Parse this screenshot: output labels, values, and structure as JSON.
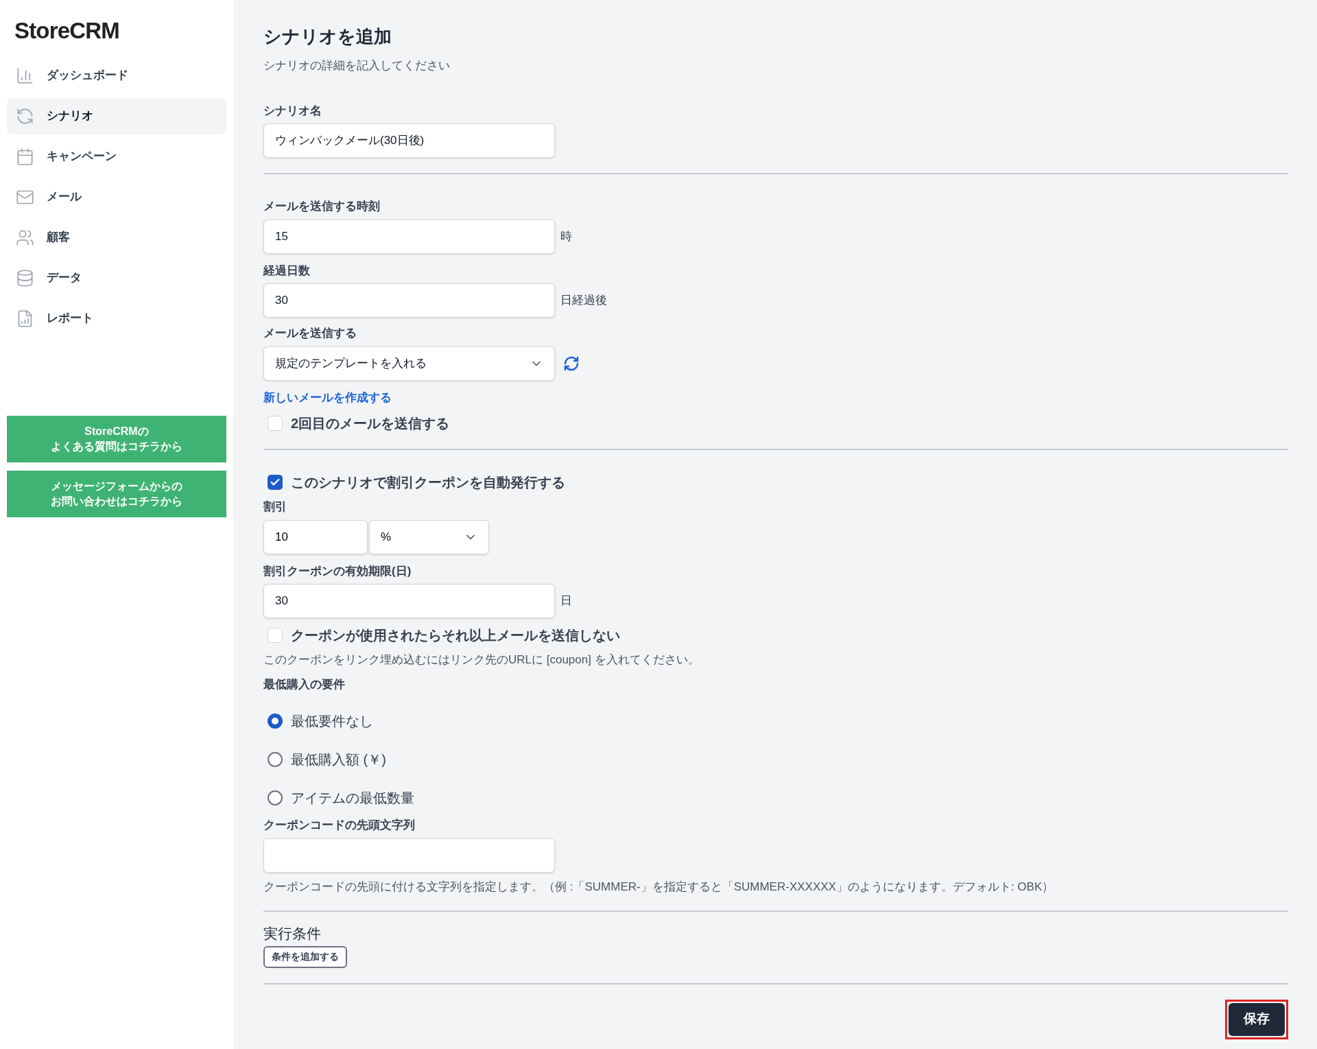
{
  "sidebar": {
    "logo": "StoreCRM",
    "items": [
      {
        "label": "ダッシュボード",
        "selected": false
      },
      {
        "label": "シナリオ",
        "selected": true
      },
      {
        "label": "キャンペーン",
        "selected": false
      },
      {
        "label": "メール",
        "selected": false
      },
      {
        "label": "顧客",
        "selected": false
      },
      {
        "label": "データ",
        "selected": false
      },
      {
        "label": "レポート",
        "selected": false
      }
    ],
    "help_buttons": [
      [
        "StoreCRMの",
        "よくある質問はコチラから"
      ],
      [
        "メッセージフォームからの",
        "お問い合わせはコチラから"
      ]
    ]
  },
  "page": {
    "title": "シナリオを追加",
    "subtitle": "シナリオの詳細を記入してください"
  },
  "form": [
    {
      "kind": "text_field",
      "label": "シナリオ名",
      "value": "ウィンバックメール(30日後)"
    },
    {
      "kind": "divider"
    },
    {
      "kind": "text_field",
      "label": "メールを送信する時刻",
      "value": "15",
      "suffix": "時"
    },
    {
      "kind": "text_field",
      "label": "経過日数",
      "value": "30",
      "suffix": "日経過後"
    },
    {
      "kind": "select",
      "label": "メールを送信する",
      "value": "規定のテンプレートを入れる"
    },
    {
      "kind": "link",
      "text": "新しいメールを作成する"
    },
    {
      "kind": "checkbox",
      "label": "2回目のメールを送信する",
      "checked": false
    },
    {
      "kind": "divider"
    },
    {
      "kind": "checkbox",
      "label": "このシナリオで割引クーポンを自動発行する",
      "checked": true
    },
    {
      "kind": "amount",
      "label": "割引",
      "value": "10",
      "unit": "%"
    },
    {
      "kind": "text_field",
      "label": "割引クーポンの有効期限(日)",
      "value": "30",
      "suffix": "日"
    },
    {
      "kind": "checkbox",
      "label": "クーポンが使用されたらそれ以上メールを送信しない",
      "checked": false
    },
    {
      "kind": "help",
      "text": "このクーポンをリンク埋め込むにはリンク先のURLに [coupon] を入れてください。"
    },
    {
      "kind": "radio_group",
      "label": "最低購入の要件",
      "options": [
        {
          "label": "最低要件なし",
          "selected": true
        },
        {
          "label": "最低購入額 (￥)",
          "selected": false
        },
        {
          "label": "アイテムの最低数量",
          "selected": false
        }
      ]
    },
    {
      "kind": "text_field",
      "label": "クーポンコードの先頭文字列"
    },
    {
      "kind": "help",
      "text": "クーポンコードの先頭に付ける文字列を指定します。（例 :「SUMMER-」を指定すると「SUMMER-XXXXXX」のようになります。デフォルト: OBK）"
    },
    {
      "kind": "divider"
    },
    {
      "kind": "heading",
      "text": "実行条件"
    },
    {
      "kind": "button",
      "text": "条件を追加する"
    },
    {
      "kind": "divider"
    }
  ],
  "save_button": "保存"
}
